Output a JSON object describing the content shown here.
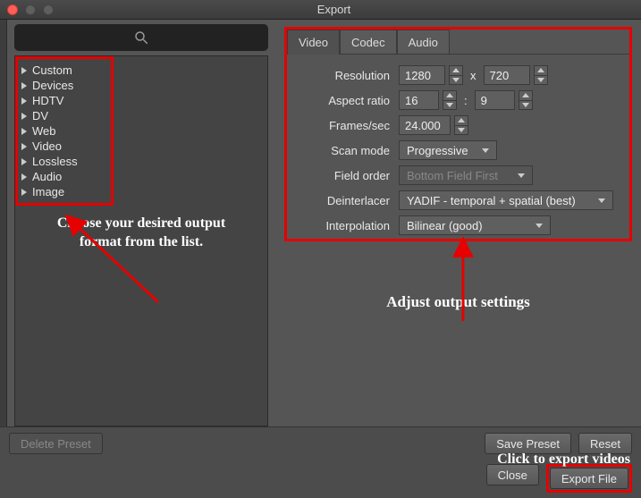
{
  "window": {
    "title": "Export"
  },
  "search": {
    "placeholder": ""
  },
  "presets": [
    "Custom",
    "Devices",
    "HDTV",
    "DV",
    "Web",
    "Video",
    "Lossless",
    "Audio",
    "Image"
  ],
  "annotations": {
    "left": "Choose your desired output format from the list.",
    "right": "Adjust output settings",
    "bottom": "Click to export videos"
  },
  "tabs": {
    "video": "Video",
    "codec": "Codec",
    "audio": "Audio",
    "active": "video"
  },
  "settings": {
    "resolution_label": "Resolution",
    "resolution_w": "1280",
    "resolution_h": "720",
    "resolution_sep": "x",
    "aspect_label": "Aspect ratio",
    "aspect_w": "16",
    "aspect_h": "9",
    "aspect_sep": ":",
    "fps_label": "Frames/sec",
    "fps_value": "24.000",
    "scanmode_label": "Scan mode",
    "scanmode_value": "Progressive",
    "fieldorder_label": "Field order",
    "fieldorder_value": "Bottom Field First",
    "deinterlacer_label": "Deinterlacer",
    "deinterlacer_value": "YADIF - temporal + spatial (best)",
    "interpolation_label": "Interpolation",
    "interpolation_value": "Bilinear (good)"
  },
  "buttons": {
    "delete_preset": "Delete Preset",
    "save_preset": "Save Preset",
    "reset": "Reset",
    "close": "Close",
    "export_file": "Export File"
  }
}
